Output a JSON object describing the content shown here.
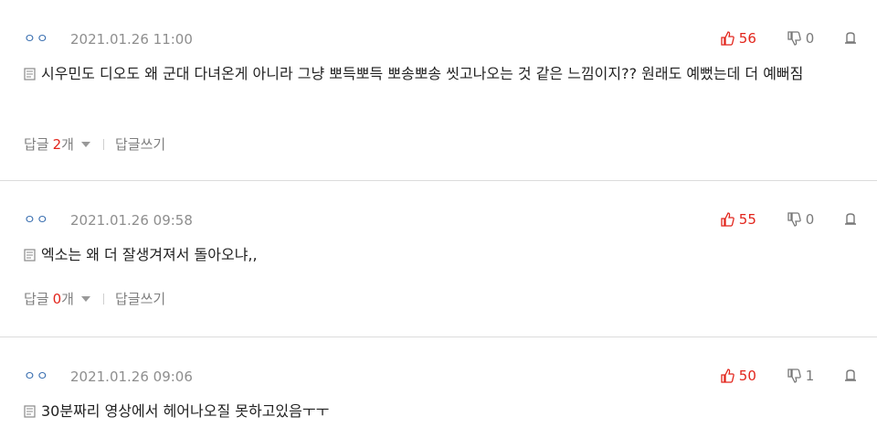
{
  "comments": [
    {
      "nick": "ㅇㅇ",
      "date": "2021.01.26 11:00",
      "likes": "56",
      "dislikes": "0",
      "text": "시우민도 디오도 왜 군대 다녀온게 아니라 그냥 뽀득뽀득 뽀송뽀송 씻고나오는 것 같은 느낌이지?? 원래도 예뻤는데 더 예뻐짐",
      "reply_label": "답글",
      "reply_count": "2",
      "reply_unit": "개",
      "write_reply": "답글쓰기"
    },
    {
      "nick": "ㅇㅇ",
      "date": "2021.01.26 09:58",
      "likes": "55",
      "dislikes": "0",
      "text": "엑소는 왜 더 잘생겨져서 돌아오냐,,",
      "reply_label": "답글",
      "reply_count": "0",
      "reply_unit": "개",
      "write_reply": "답글쓰기"
    },
    {
      "nick": "ㅇㅇ",
      "date": "2021.01.26 09:06",
      "likes": "50",
      "dislikes": "1",
      "text": "30분짜리 영상에서 헤어나오질 못하고있음ㅜㅜ"
    }
  ],
  "colors": {
    "accent_red": "#e2251c",
    "nick_blue": "#3a6fb0",
    "meta_gray": "#8e8e8e"
  },
  "icons": {
    "like": "thumbs-up-icon",
    "dislike": "thumbs-down-icon",
    "report": "report-icon",
    "comment": "comment-doc-icon"
  }
}
